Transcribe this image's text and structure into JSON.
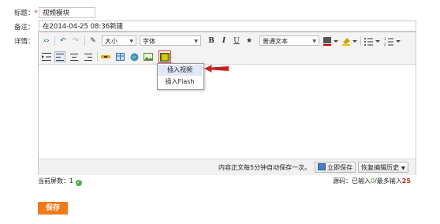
{
  "form": {
    "title_label": "标题：",
    "required_mark": "*",
    "title_value": "视频模块",
    "note_label": "备注：",
    "note_value": "在2014-04-25 08:36新建",
    "detail_label": "详情："
  },
  "toolbar": {
    "font_size": "大小",
    "font_family": "字体",
    "bold": "B",
    "italic": "I",
    "underline": "U",
    "format": "普通文本"
  },
  "insert_menu": {
    "items": [
      "插入视频",
      "插入Flash"
    ]
  },
  "status_bar": {
    "autosave_text": "内容正文每5分钟自动保存一次。",
    "save_now": "立即保存",
    "restore_history": "恢复编辑历史"
  },
  "below_editor": {
    "page_count_label": "当前屏数：",
    "page_count_value": "1",
    "source_label": "源码：已输入",
    "source_entered": "0",
    "source_sep": "/最多输入",
    "source_max": "25"
  },
  "actions": {
    "save_label": "保存"
  },
  "colors": {
    "accent": "#f07a1a",
    "required": "#e02020",
    "arrow": "#c8201e",
    "count_green": "#2a9c2a"
  }
}
